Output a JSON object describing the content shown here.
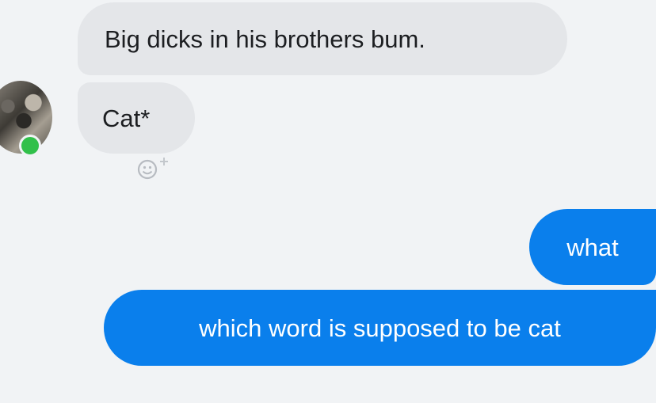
{
  "conversation": {
    "messages": [
      {
        "sender": "them",
        "text": "Big dicks in his brothers bum."
      },
      {
        "sender": "them",
        "text": "Cat*"
      },
      {
        "sender": "me",
        "text": "what"
      },
      {
        "sender": "me",
        "text": "which word is supposed to be cat"
      }
    ]
  },
  "contact": {
    "online": true,
    "avatar_icon": "cat-photo"
  },
  "reaction": {
    "icon": "add-reaction-icon"
  },
  "colors": {
    "background": "#f1f3f5",
    "incoming_bubble": "#e4e6e9",
    "outgoing_bubble": "#0a7fec",
    "online_status": "#31c04a"
  }
}
